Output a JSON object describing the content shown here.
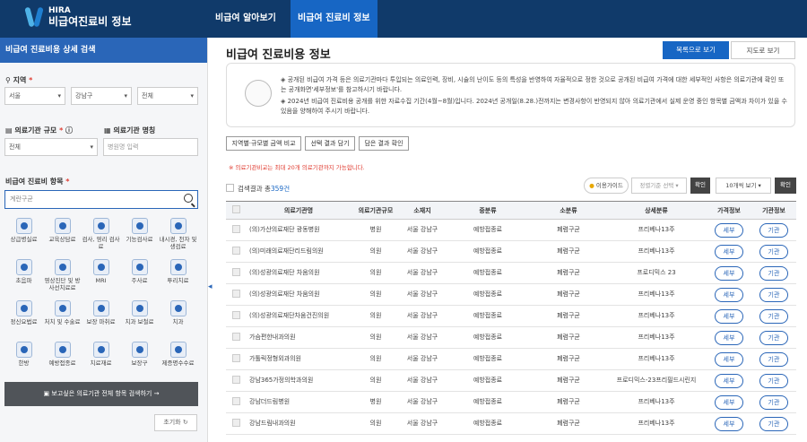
{
  "header": {
    "logo_en": "HIRA",
    "logo_ko": "비급여진료비 정보",
    "nav": [
      "비급여 알아보기",
      "비급여 진료비 정보"
    ]
  },
  "sidebar": {
    "title": "비급여 진료비용 상세 검색",
    "region_label": "지역",
    "region_selects": [
      "서울",
      "강남구",
      "전체"
    ],
    "scale_label": "의료기관 규모",
    "name_label": "의료기관 명칭",
    "scale_value": "전체",
    "name_placeholder": "병원명 입력",
    "item_label": "비급여 진료비 항목",
    "item_placeholder": "계란구균",
    "categories": [
      "상급병실료",
      "교육상담료",
      "검사, 영리 검사료",
      "기능검사료",
      "내시경, 천자 및 생검료",
      "초음파",
      "영상진단 및 방사선치료료",
      "MRI",
      "주사료",
      "투리치료",
      "정신요법료",
      "처치 및 수술료",
      "보장 마취료",
      "치과 보철료",
      "치과",
      "한방",
      "예방접종료",
      "치료재료",
      "보장구",
      "제증명수수료"
    ],
    "search_button": "보고싶은 의료기관 전체 항목 검색하기",
    "reset": "초기화"
  },
  "main": {
    "title": "비급여 진료비용 정보",
    "view_list": "목록으로 보기",
    "view_map": "지도로 보기",
    "notice": [
      "◈ 공개된 비급여 가격 등은 의료기관마다 투입되는 의료인력, 장비, 시술의 난이도 등의 특성을 반영하여 자율적으로 정한 것으로 공개된 비급여 가격에 대한 세부적인 사항은 의료기관에 확인 또는 공개화면'세부정보'를 참고하시기 바랍니다.",
      "◈ 2024년 비급여 진료비용 공개를 위한 자료수집 기간(4월~8월)입니다. 2024년 공개일(8.28.)전까지는 변경사항이 반영되지 않아 의료기관에서 실제 운영 중인 항목별 금액과 차이가 있을 수 있음을 양해하여 주시기 바랍니다."
    ],
    "tab_buttons": [
      "지역별·규모별 금액 비교",
      "선택 결과 담기",
      "담은 결과 확인"
    ],
    "warning": "※ 의료기관비교는 최대 20개 의료기관까지 가능합니다.",
    "result_prefix": "검색결과 총",
    "result_count": "359건",
    "guide": "이용가이드",
    "sort_placeholder": "정렬기준 선택",
    "confirm": "확인",
    "per_page": "10개씩 보기",
    "columns": [
      "의료기관명",
      "의료기관규모",
      "소재지",
      "중분류",
      "소분류",
      "상세분류",
      "가격정보",
      "기관정보"
    ],
    "detail_btn": "세부",
    "org_btn": "기관",
    "rows": [
      [
        "(의)가산의료재단 광동병원",
        "병원",
        "서울 강남구",
        "예방접종료",
        "폐렴구균",
        "프리베나13주"
      ],
      [
        "(의)미래의료재단리드림의원",
        "의원",
        "서울 강남구",
        "예방접종료",
        "폐렴구균",
        "프리베나13주"
      ],
      [
        "(의)성광의료재단 차움의원",
        "의원",
        "서울 강남구",
        "예방접종료",
        "폐렴구균",
        "프로디믹스 23"
      ],
      [
        "(의)성광의료재단 차움의원",
        "의원",
        "서울 강남구",
        "예방접종료",
        "폐렴구균",
        "프리베나13주"
      ],
      [
        "(의)성광의료재단차움건진의원",
        "의원",
        "서울 강남구",
        "예방접종료",
        "폐렴구균",
        "프리베나13주"
      ],
      [
        "가슴편한내과의원",
        "의원",
        "서울 강남구",
        "예방접종료",
        "폐렴구균",
        "프리베나13주"
      ],
      [
        "가톨릭정형외과의원",
        "의원",
        "서울 강남구",
        "예방접종료",
        "폐렴구균",
        "프리베나13주"
      ],
      [
        "강남365가정의학과의원",
        "의원",
        "서울 강남구",
        "예방접종료",
        "폐렴구균",
        "프로디믹스-23프리필드시린지"
      ],
      [
        "강남더드림병원",
        "병원",
        "서울 강남구",
        "예방접종료",
        "폐렴구균",
        "프리베나13주"
      ],
      [
        "강남드림내과의원",
        "의원",
        "서울 강남구",
        "예방접종료",
        "폐렴구균",
        "프리베나13주"
      ]
    ]
  }
}
